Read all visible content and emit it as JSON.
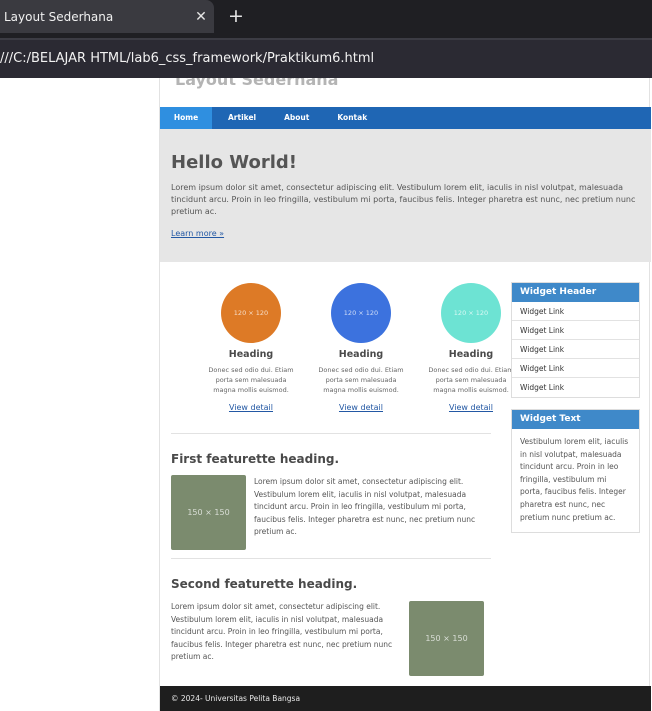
{
  "browser": {
    "tab_title": "Layout Sederhana",
    "close_glyph": "✕",
    "new_tab_glyph": "+",
    "address": "///C:/BELAJAR HTML/lab6_css_framework/Praktikum6.html"
  },
  "page": {
    "site_title": "Layout Sederhana",
    "nav": [
      {
        "label": "Home",
        "active": true
      },
      {
        "label": "Artikel",
        "active": false
      },
      {
        "label": "About",
        "active": false
      },
      {
        "label": "Kontak",
        "active": false
      }
    ],
    "hero": {
      "title": "Hello World!",
      "text": "Lorem ipsum dolor sit amet, consectetur adipiscing elit. Vestibulum lorem elit, iaculis in nisl volutpat, malesuada tincidunt arcu. Proin in leo fringilla, vestibulum mi porta, faucibus felis. Integer pharetra est nunc, nec pretium nunc pretium ac.",
      "link": "Learn more »"
    },
    "columns": [
      {
        "placeholder": "120 × 120",
        "color": "#dd7a26",
        "heading": "Heading",
        "text": "Donec sed odio dui. Etiam porta sem malesuada magna mollis euismod.",
        "link": "View detail"
      },
      {
        "placeholder": "120 × 120",
        "color": "#3c72de",
        "heading": "Heading",
        "text": "Donec sed odio dui. Etiam porta sem malesuada magna mollis euismod.",
        "link": "View detail"
      },
      {
        "placeholder": "120 × 120",
        "color": "#6de3d3",
        "heading": "Heading",
        "text": "Donec sed odio dui. Etiam porta sem malesuada magna mollis euismod.",
        "link": "View detail"
      }
    ],
    "featurettes": [
      {
        "heading": "First featurette heading.",
        "image": "150 × 150",
        "text": "Lorem ipsum dolor sit amet, consectetur adipiscing elit. Vestibulum lorem elit, iaculis in nisl volutpat, malesuada tincidunt arcu. Proin in leo fringilla, vestibulum mi porta, faucibus felis. Integer pharetra est nunc, nec pretium nunc pretium ac."
      },
      {
        "heading": "Second featurette heading.",
        "image": "150 × 150",
        "text": "Lorem ipsum dolor sit amet, consectetur adipiscing elit. Vestibulum lorem elit, iaculis in nisl volutpat, malesuada tincidunt arcu. Proin in leo fringilla, vestibulum mi porta, faucibus felis. Integer pharetra est nunc, nec pretium nunc pretium ac."
      }
    ],
    "widget_links": {
      "header": "Widget Header",
      "links": [
        "Widget Link",
        "Widget Link",
        "Widget Link",
        "Widget Link",
        "Widget Link"
      ]
    },
    "widget_text": {
      "header": "Widget Text",
      "body": "Vestibulum lorem elit, iaculis in nisl volutpat, malesuada tincidunt arcu. Proin in leo fringilla, vestibulum mi porta, faucibus felis. Integer pharetra est nunc, nec pretium nunc pretium ac."
    },
    "footer": "© 2024- Universitas Pelita Bangsa"
  },
  "colors": {
    "nav_bar": "#1f66b4",
    "nav_active": "#2f8fe0",
    "widget_header": "#3f89c9",
    "placeholder_image": "#7b8b6e",
    "footer": "#1e1e1e"
  }
}
